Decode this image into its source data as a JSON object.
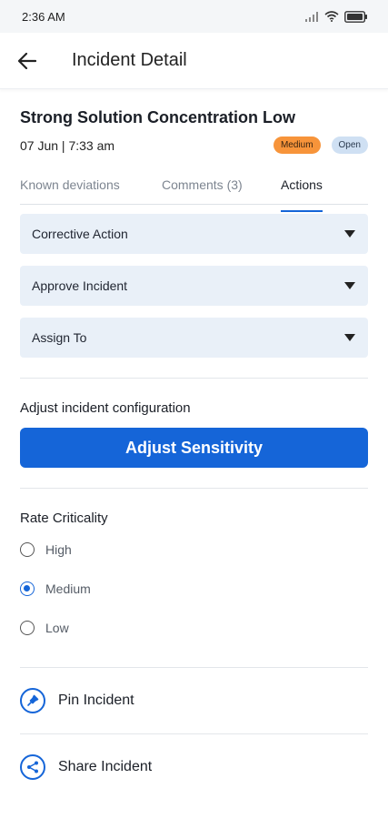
{
  "status_bar": {
    "time": "2:36 AM",
    "icons": [
      "signal-icon",
      "wifi-icon",
      "battery-icon"
    ]
  },
  "app_bar": {
    "title": "Incident Detail",
    "back_icon": "arrow-left-icon"
  },
  "incident": {
    "title": "Strong Solution Concentration Low",
    "date": "07 Jun | 7:33 am",
    "severity_badge": "Medium",
    "status_badge": "Open"
  },
  "tabs": [
    {
      "label": "Known deviations",
      "active": false
    },
    {
      "label": "Comments (3)",
      "active": false
    },
    {
      "label": "Actions",
      "active": true
    }
  ],
  "dropdowns": [
    {
      "label": "Corrective Action"
    },
    {
      "label": "Approve Incident"
    },
    {
      "label": "Assign To"
    }
  ],
  "configuration": {
    "title": "Adjust incident configuration",
    "button_label": "Adjust Sensitivity"
  },
  "criticality": {
    "title": "Rate Criticality",
    "options": [
      "High",
      "Medium",
      "Low"
    ],
    "selected": "Medium"
  },
  "actions": {
    "pin_label": "Pin Incident",
    "share_label": "Share Incident"
  },
  "colors": {
    "accent": "#1565d8",
    "medium_badge": "#f7943a",
    "open_badge": "#cfe0f3",
    "dropdown_bg": "#e9f0f8"
  }
}
